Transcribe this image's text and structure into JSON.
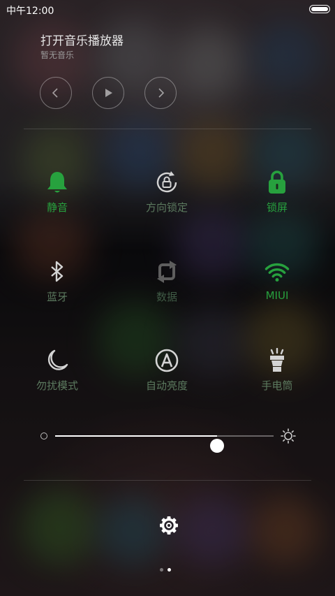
{
  "status_bar": {
    "time": "中午12:00"
  },
  "music": {
    "title": "打开音乐播放器",
    "subtitle": "暂无音乐",
    "controls": [
      "previous-icon",
      "play-icon",
      "next-icon"
    ]
  },
  "toggles": [
    {
      "label": "静音",
      "icon": "bell-icon",
      "state": "on"
    },
    {
      "label": "方向锁定",
      "icon": "rotation-lock-icon",
      "state": "off"
    },
    {
      "label": "锁屏",
      "icon": "padlock-icon",
      "state": "on"
    },
    {
      "label": "蓝牙",
      "icon": "bluetooth-icon",
      "state": "off"
    },
    {
      "label": "数据",
      "icon": "mobile-data-icon",
      "state": "disabled"
    },
    {
      "label": "MIUI",
      "icon": "wifi-icon",
      "state": "on"
    },
    {
      "label": "勿扰模式",
      "icon": "moon-icon",
      "state": "off"
    },
    {
      "label": "自动亮度",
      "icon": "auto-brightness-icon",
      "state": "off"
    },
    {
      "label": "手电筒",
      "icon": "flashlight-icon",
      "state": "off"
    }
  ],
  "brightness": {
    "level_percent": 74
  },
  "pager": {
    "pages": 2,
    "current": 2
  },
  "colors": {
    "accent_on": "#27a13e",
    "label_off": "#5c7a5f",
    "icon_off": "#d4d4d4"
  }
}
